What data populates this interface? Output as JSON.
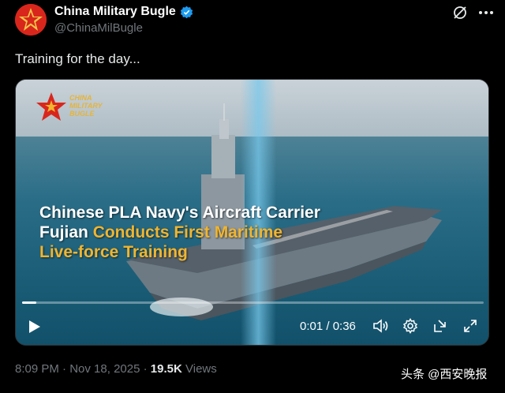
{
  "author": {
    "name": "China Military Bugle",
    "handle": "@ChinaMilBugle"
  },
  "tweet": {
    "text": "Training for the day..."
  },
  "video": {
    "logo_line1": "CHINA",
    "logo_line2": "MILITARY",
    "logo_line3": "BUGLE",
    "headline_part1": "Chinese PLA Navy's Aircraft Carrier",
    "headline_part2": "Fujian",
    "headline_part3": "Conducts First Maritime",
    "headline_part4": "Live-force Training",
    "time_display": "0:01 / 0:36",
    "progress": 0.03
  },
  "meta": {
    "time": "8:09 PM",
    "date": "Nov 18, 2025",
    "views_count": "19.5K",
    "views_label": "Views"
  },
  "watermark": "头条 @西安晚报",
  "colors": {
    "accent_gold": "#f1b52f",
    "verified_blue": "#1d9bf0",
    "brand_red": "#d9261c"
  }
}
